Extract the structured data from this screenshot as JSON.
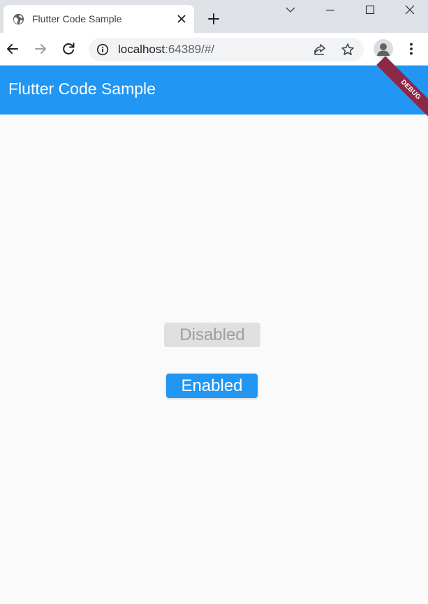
{
  "browser": {
    "tab": {
      "title": "Flutter Code Sample",
      "favicon": "globe-icon",
      "close_icon": "close-icon"
    },
    "new_tab_icon": "plus-icon",
    "window_controls": [
      "chevron-down-icon",
      "minimize-icon",
      "maximize-icon",
      "close-icon"
    ],
    "toolbar": {
      "back_icon": "back-arrow-icon",
      "forward_icon": "forward-arrow-icon",
      "reload_icon": "reload-icon",
      "url_host": "localhost",
      "url_rest": ":64389/#/",
      "site_info_icon": "info-icon",
      "share_icon": "share-icon",
      "bookmark_icon": "star-icon",
      "profile_icon": "profile-icon",
      "menu_icon": "kebab-menu-icon"
    }
  },
  "app": {
    "appbar_title": "Flutter Code Sample",
    "debug_banner": "DEBUG",
    "buttons": {
      "disabled_label": "Disabled",
      "enabled_label": "Enabled"
    },
    "colors": {
      "primary": "#2196f3",
      "debug_banner": "#8b2846",
      "disabled_bg": "#e0e0e0",
      "disabled_text": "#9e9e9e",
      "background": "#fafafa"
    }
  }
}
